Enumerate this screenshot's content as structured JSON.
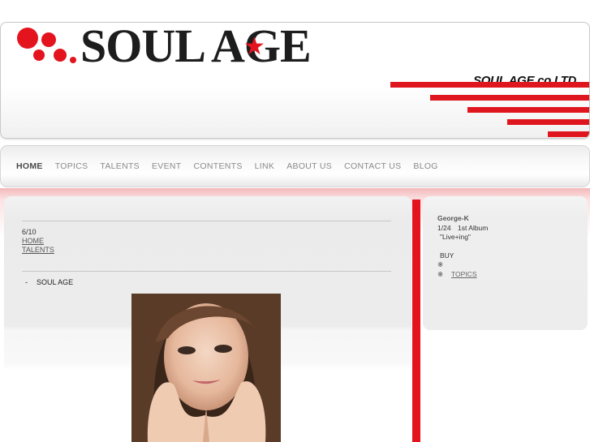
{
  "header": {
    "logo_text": "SOUL AGE",
    "company": "SOUL AGE co.LTD",
    "accent_color": "#e3141e"
  },
  "nav": {
    "items": [
      "HOME",
      "TOPICS",
      "TALENTS",
      "EVENT",
      "CONTENTS",
      "LINK",
      "ABOUT US",
      "CONTACT US",
      "BLOG"
    ],
    "active": "HOME"
  },
  "main": {
    "date": "6/10",
    "breadcrumb": [
      "HOME",
      "TALENTS"
    ],
    "item_bullet": "-",
    "item_text": "SOUL AGE",
    "photo_icon": "portrait-photo"
  },
  "side": {
    "artist": "George-K",
    "release": "1/24　1st Album",
    "album_title": "\"Live+ing\"",
    "buy": "BUY",
    "mark1": "※",
    "mark2": "※",
    "topics_link": "TOPICS"
  }
}
